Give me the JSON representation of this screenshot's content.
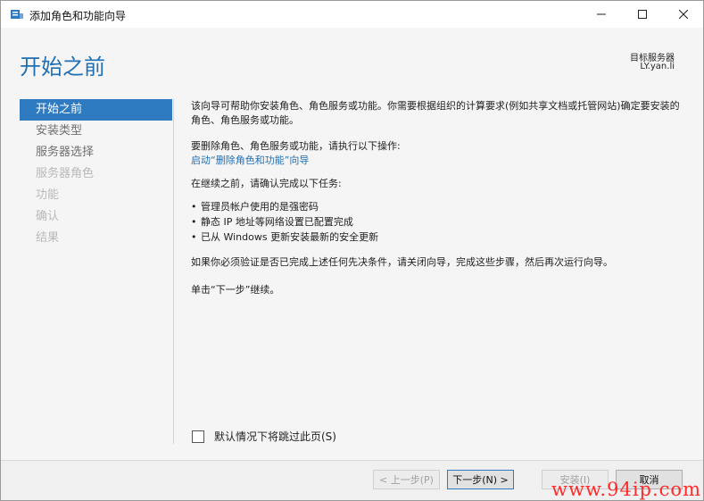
{
  "window": {
    "title": "添加角色和功能向导",
    "icon": "server-manager-icon"
  },
  "header": {
    "page_title": "开始之前",
    "target_label": "目标服务器",
    "target_value": "LY.yan.li"
  },
  "nav": {
    "items": [
      {
        "label": "开始之前",
        "state": "active"
      },
      {
        "label": "安装类型",
        "state": "enabled"
      },
      {
        "label": "服务器选择",
        "state": "enabled"
      },
      {
        "label": "服务器角色",
        "state": "disabled"
      },
      {
        "label": "功能",
        "state": "disabled"
      },
      {
        "label": "确认",
        "state": "disabled"
      },
      {
        "label": "结果",
        "state": "disabled"
      }
    ]
  },
  "content": {
    "para1": "该向导可帮助你安装角色、角色服务或功能。你需要根据组织的计算要求(例如共享文档或托管网站)确定要安装的角色、角色服务或功能。",
    "para2": "要删除角色、角色服务或功能，请执行以下操作:",
    "remove_link": "启动“删除角色和功能”向导",
    "para3": "在继续之前，请确认完成以下任务:",
    "bullets": [
      "管理员帐户使用的是强密码",
      "静态 IP 地址等网络设置已配置完成",
      "已从 Windows 更新安装最新的安全更新"
    ],
    "para4": "如果你必须验证是否已完成上述任何先决条件，请关闭向导，完成这些步骤，然后再次运行向导。",
    "para5": "单击“下一步”继续。"
  },
  "skip_checkbox": {
    "label": "默认情况下将跳过此页(S)",
    "checked": false
  },
  "footer": {
    "prev": "< 上一步(P)",
    "next": "下一步(N) >",
    "install": "安装(I)",
    "cancel": "取消"
  },
  "watermark": "www.94ip.com",
  "colors": {
    "accent": "#2e7bc1",
    "title": "#1f6fb2",
    "watermark": "#ff2a2a"
  }
}
